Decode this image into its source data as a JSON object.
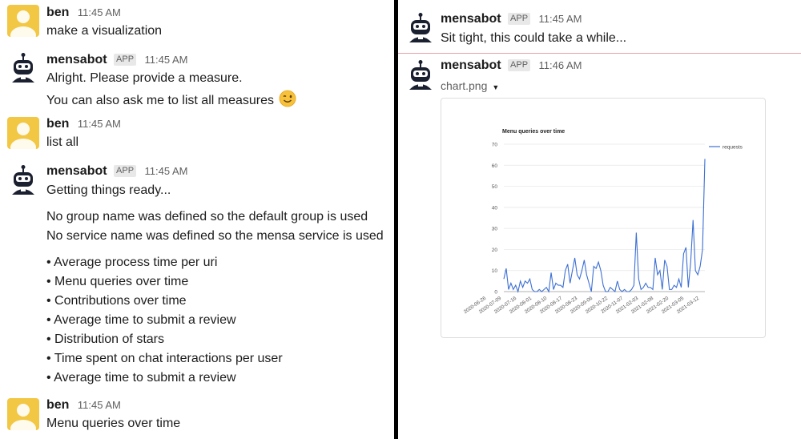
{
  "left": {
    "messages": [
      {
        "sender": "ben",
        "time": "11:45 AM",
        "lines": [
          "make a visualization"
        ]
      },
      {
        "sender": "mensabot",
        "badge": "APP",
        "time": "11:45 AM",
        "lines": [
          "Alright. Please provide a measure.",
          "You can also ask me to list all measures"
        ],
        "emoji": "winking-face"
      },
      {
        "sender": "ben",
        "time": "11:45 AM",
        "lines": [
          "list all"
        ]
      },
      {
        "sender": "mensabot",
        "badge": "APP",
        "time": "11:45 AM",
        "lines": [
          "Getting things ready...",
          "No group name was defined so the default group is used",
          "No service name was defined so the mensa service is used"
        ],
        "bullets": [
          "Average process time per uri",
          "Menu queries over time",
          "Contributions over time",
          "Average time to submit a review",
          "Distribution of stars",
          "Time spent on chat interactions per user",
          "Average time to submit a review"
        ]
      },
      {
        "sender": "ben",
        "time": "11:45 AM",
        "lines": [
          "Menu queries over time"
        ]
      }
    ]
  },
  "right": {
    "messages": [
      {
        "sender": "mensabot",
        "badge": "APP",
        "time": "11:45 AM",
        "lines": [
          "Sit tight, this could take a while..."
        ]
      },
      {
        "sender": "mensabot",
        "badge": "APP",
        "time": "11:46 AM",
        "attachment": "chart.png"
      }
    ]
  },
  "colors": {
    "user_avatar": "#f2c744",
    "line": "#3c6fd3",
    "grid": "#e6e6e6"
  },
  "chart_data": {
    "type": "line",
    "title": "Menu queries over time",
    "series": [
      {
        "name": "requests",
        "values": [
          6,
          11,
          1,
          4,
          1,
          3,
          0,
          5,
          2,
          5,
          4,
          6,
          1,
          0,
          0,
          1,
          0,
          1,
          2,
          0,
          9,
          1,
          4,
          3,
          3,
          2,
          10,
          13,
          4,
          10,
          16,
          8,
          6,
          10,
          15,
          8,
          4,
          0,
          12,
          11,
          14,
          10,
          3,
          0,
          0,
          2,
          1,
          0,
          5,
          1,
          0,
          1,
          0,
          0,
          1,
          3,
          28,
          6,
          1,
          2,
          4,
          2,
          2,
          1,
          16,
          8,
          10,
          1,
          15,
          12,
          1,
          1,
          3,
          2,
          6,
          2,
          18,
          21,
          2,
          14,
          34,
          10,
          8,
          12,
          20,
          63
        ]
      }
    ],
    "x_ticks": [
      "2020-06-26",
      "2020-07-09",
      "2020-07-16",
      "2020-08-01",
      "2020-08-10",
      "2020-08-17",
      "2020-08-23",
      "2020-09-06",
      "2020-10-22",
      "2020-11-07",
      "2021-02-03",
      "2021-02-08",
      "2021-02-20",
      "2021-03-05",
      "2021-03-12"
    ],
    "ylim": [
      0,
      70
    ],
    "yticks": [
      0,
      10,
      20,
      30,
      40,
      50,
      60,
      70
    ],
    "grid": true,
    "legend": "top-right"
  }
}
